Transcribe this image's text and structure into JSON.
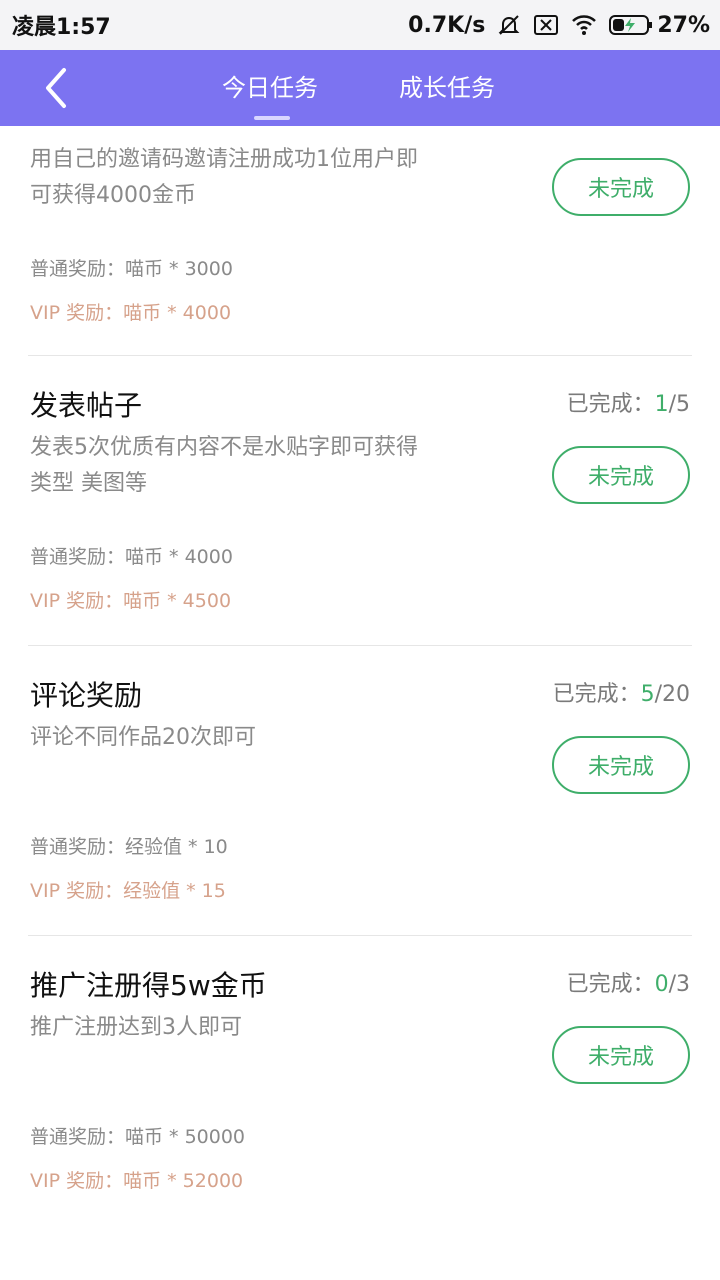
{
  "status_bar": {
    "time": "凌晨1:57",
    "network_speed": "0.7K/s",
    "battery": "27%",
    "icons": [
      "bell-muted-icon",
      "sim-off-icon",
      "wifi-icon",
      "battery-charging-icon"
    ]
  },
  "header": {
    "tabs": [
      {
        "label": "今日任务",
        "active": true
      },
      {
        "label": "成长任务",
        "active": false
      }
    ],
    "accent_color": "#7c73f1"
  },
  "tasks": [
    {
      "title": "",
      "desc": "用自己的邀请码邀请注册成功1位用户即可获得4000金币",
      "progress_label": "",
      "progress_done": "",
      "progress_total": "",
      "button": "未完成",
      "normal_reward": "普通奖励：喵币 * 3000",
      "vip_reward": "VIP 奖励：喵币 * 4000"
    },
    {
      "title": "发表帖子",
      "desc": "发表5次优质有内容不是水贴字即可获得 类型 美图等",
      "progress_label": "已完成：",
      "progress_done": "1",
      "progress_total": "/5",
      "button": "未完成",
      "normal_reward": "普通奖励：喵币 * 4000",
      "vip_reward": "VIP 奖励：喵币 * 4500"
    },
    {
      "title": "评论奖励",
      "desc": "评论不同作品20次即可",
      "progress_label": "已完成：",
      "progress_done": "5",
      "progress_total": "/20",
      "button": "未完成",
      "normal_reward": "普通奖励：经验值 * 10",
      "vip_reward": "VIP 奖励：经验值 * 15"
    },
    {
      "title": "推广注册得5w金币",
      "desc": "推广注册达到3人即可",
      "progress_label": "已完成：",
      "progress_done": "0",
      "progress_total": "/3",
      "button": "未完成",
      "normal_reward": "普通奖励：喵币 * 50000",
      "vip_reward": "VIP 奖励：喵币 * 52000"
    }
  ],
  "colors": {
    "done_green": "#3fae6a",
    "vip_text": "#d6a28b",
    "muted_text": "#8a8a8a"
  }
}
